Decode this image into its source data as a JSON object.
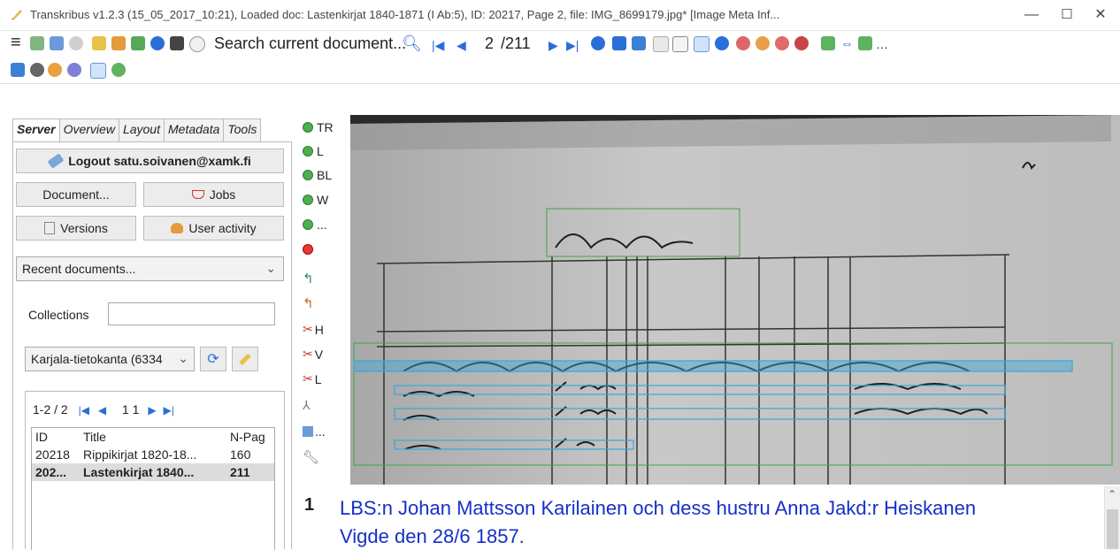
{
  "window": {
    "title": "Transkribus v1.2.3 (15_05_2017_10:21), Loaded doc: Lastenkirjat 1840-1871 (I Ab:5), ID: 20217, Page 2, file: IMG_8699179.jpg* [Image Meta Inf...",
    "minimize": "—",
    "maximize": "☐",
    "close": "✕"
  },
  "toolbar": {
    "search_label": "Search current document...",
    "page_current": "2",
    "page_total": "/211"
  },
  "left": {
    "tabs": [
      "Server",
      "Overview",
      "Layout",
      "Metadata",
      "Tools"
    ],
    "logout_label": "Logout satu.soivanen@xamk.fi",
    "document_button": "Document...",
    "jobs_button": "Jobs",
    "versions_button": "Versions",
    "user_activity_button": "User activity",
    "recent_docs": "Recent documents...",
    "collections_label": "Collections",
    "collections_value": "",
    "collection_selected": "Karjala-tietokanta (6334",
    "pager_text": "1-2 / 2",
    "pager_page": "1",
    "pager_of": "1",
    "doc_table": {
      "headers": [
        "ID",
        "Title",
        "N-Pag"
      ],
      "rows": [
        [
          "20218",
          "Rippikirjat 1820-18...",
          "160"
        ],
        [
          "202...",
          "Lastenkirjat 1840...",
          "211"
        ]
      ]
    }
  },
  "mid_tools": [
    "TR",
    "L",
    "BL",
    "W",
    "...",
    "H",
    "V",
    "L",
    "..."
  ],
  "editor": {
    "line_number": "1",
    "line_text_1": "LBS:n Johan Mattsson Karilainen och dess hustru Anna Jakd:r Heiskanen",
    "line_text_2": "Vigde den 28/6 1857."
  },
  "colors": {
    "accent_blue": "#2a6ed8",
    "text_blue": "#1530c8",
    "canvas_dark": "#2b2b2b",
    "region_green": "#3fa34d",
    "line_blue": "#3aa6d8"
  }
}
